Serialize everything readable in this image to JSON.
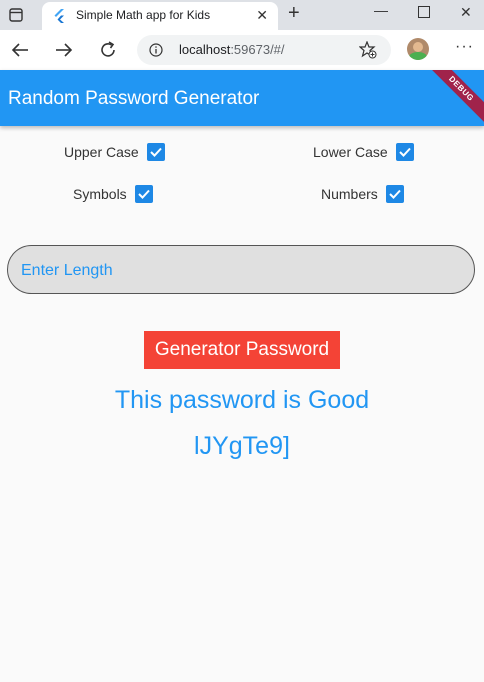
{
  "browser": {
    "tab_title": "Simple Math app for Kids",
    "url_host": "localhost",
    "url_rest": ":59673/#/"
  },
  "app": {
    "title": "Random Password Generator",
    "debug_banner": "DEBUG",
    "accent_color": "#2196f3",
    "button_color": "#f44336"
  },
  "options": {
    "upper_case": {
      "label": "Upper Case",
      "checked": true
    },
    "lower_case": {
      "label": "Lower Case",
      "checked": true
    },
    "symbols": {
      "label": "Symbols",
      "checked": true
    },
    "numbers": {
      "label": "Numbers",
      "checked": true
    }
  },
  "length_field": {
    "placeholder": "Enter Length",
    "value": ""
  },
  "generate_button": {
    "label": "Generator Password"
  },
  "result": {
    "strength_text": "This password is Good",
    "password": "lJYgTe9]"
  }
}
